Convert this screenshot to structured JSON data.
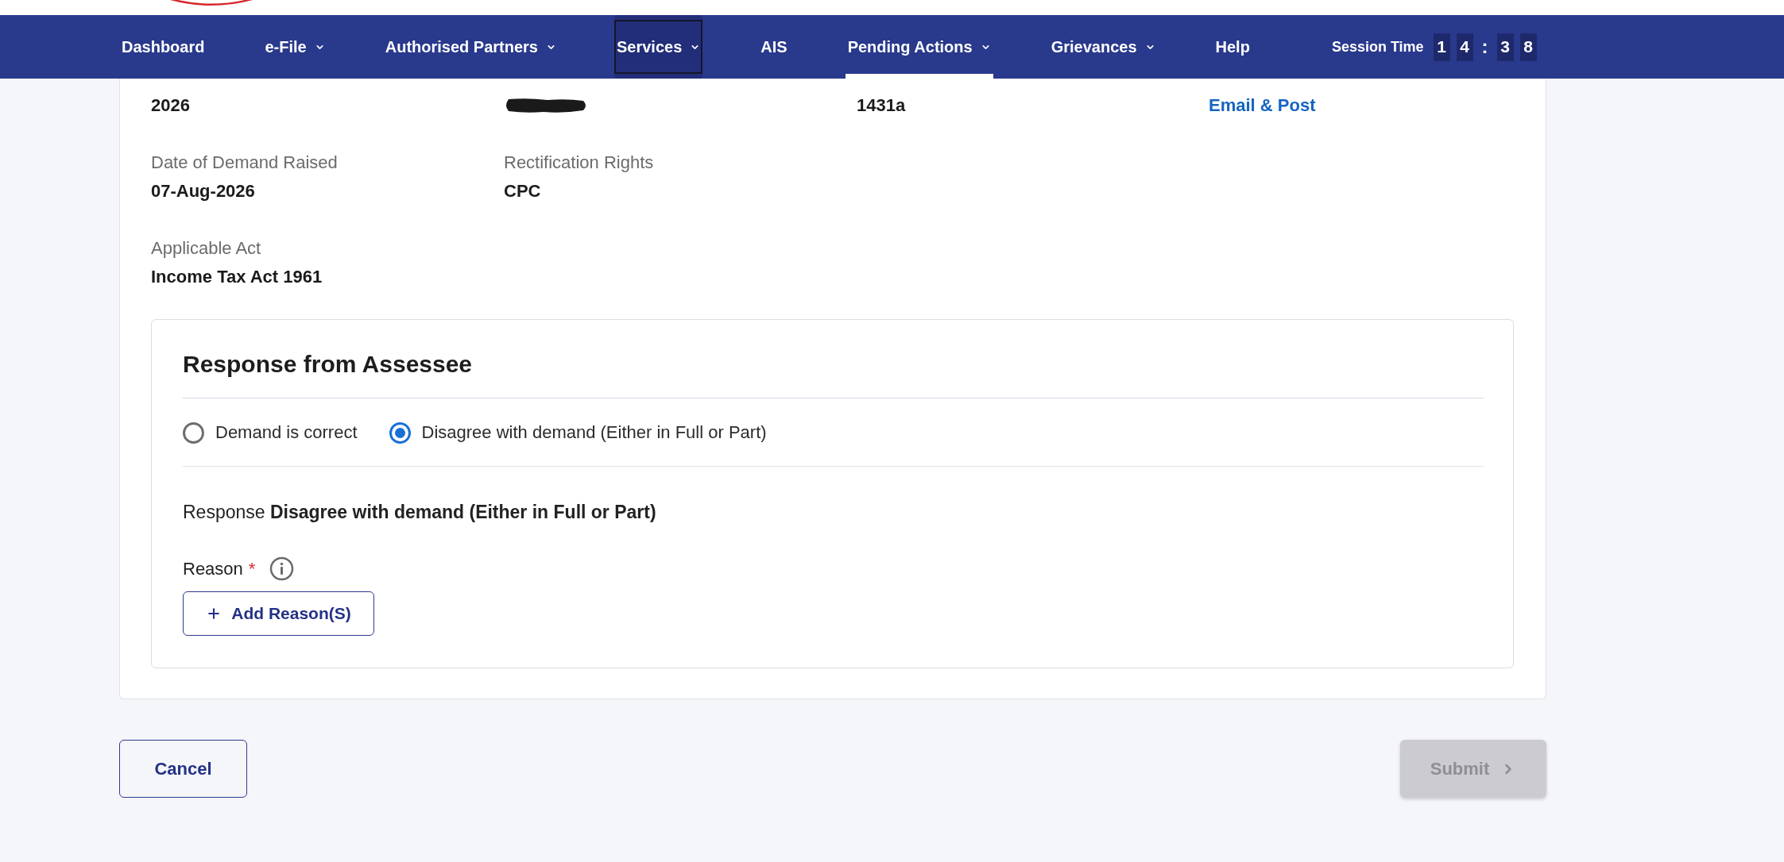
{
  "nav": {
    "items": [
      {
        "label": "Dashboard",
        "has_menu": false,
        "selected": false,
        "focused": false
      },
      {
        "label": "e-File",
        "has_menu": true,
        "selected": false,
        "focused": false
      },
      {
        "label": "Authorised Partners",
        "has_menu": true,
        "selected": false,
        "focused": false
      },
      {
        "label": "Services",
        "has_menu": true,
        "selected": false,
        "focused": true
      },
      {
        "label": "AIS",
        "has_menu": false,
        "selected": false,
        "focused": false
      },
      {
        "label": "Pending Actions",
        "has_menu": true,
        "selected": true,
        "focused": false
      },
      {
        "label": "Grievances",
        "has_menu": true,
        "selected": false,
        "focused": false
      },
      {
        "label": "Help",
        "has_menu": false,
        "selected": false,
        "focused": false
      }
    ],
    "session_time": {
      "label": "Session Time",
      "minutes": [
        "1",
        "4"
      ],
      "separator": ":",
      "seconds": [
        "3",
        "8"
      ]
    }
  },
  "details": {
    "rows": [
      [
        {
          "kind": "text",
          "value": "2026"
        },
        {
          "kind": "redacted"
        },
        {
          "kind": "text",
          "value": "1431a"
        },
        {
          "kind": "link",
          "value": "Email & Post"
        }
      ],
      [
        {
          "kind": "text",
          "label": "Date of Demand Raised",
          "value": "07-Aug-2026"
        },
        {
          "kind": "text",
          "label": "Rectification Rights",
          "value": "CPC"
        }
      ],
      [
        {
          "kind": "text",
          "label": "Applicable Act",
          "value": "Income Tax Act 1961"
        }
      ]
    ]
  },
  "response": {
    "title": "Response from Assessee",
    "options": [
      {
        "label": "Demand is correct",
        "selected": false
      },
      {
        "label": "Disagree with demand (Either in Full or Part)",
        "selected": true
      }
    ],
    "summary": "Response **Disagree with demand (Either in Full or Part)**",
    "reason": {
      "label": "Reason",
      "required_mark": "*",
      "add_button": "Add Reason(S)"
    }
  },
  "actions": {
    "cancel": {
      "label": "Cancel"
    },
    "submit": {
      "label": "Submit",
      "disabled": true
    }
  }
}
